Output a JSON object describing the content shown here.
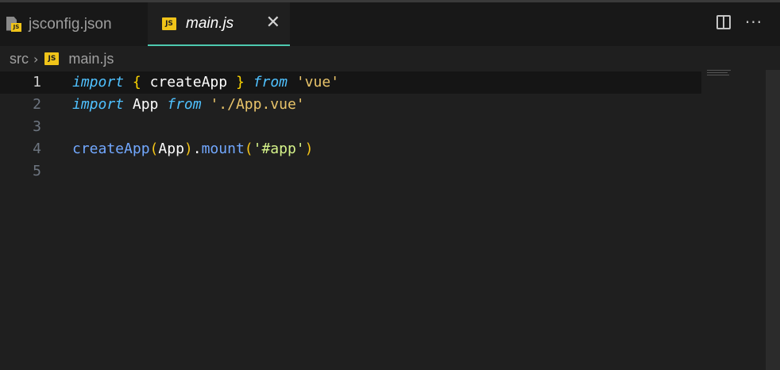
{
  "tabs": [
    {
      "label": "jsconfig.json",
      "icon": "json-file-icon",
      "active": false
    },
    {
      "label": "main.js",
      "icon": "js-file-icon",
      "active": true,
      "close": "✕"
    }
  ],
  "icons": {
    "js_badge": "JS",
    "json_badge": "JS",
    "more": "···"
  },
  "breadcrumb": {
    "folder": "src",
    "separator": "›",
    "file": "main.js"
  },
  "editor": {
    "line_numbers": [
      "1",
      "2",
      "3",
      "4",
      "5"
    ],
    "lines": {
      "l1": {
        "kw1": "import",
        "b1": "{",
        "id": "createApp",
        "b2": "}",
        "kw2": "from",
        "str": "'vue'"
      },
      "l2": {
        "kw1": "import",
        "id": "App",
        "kw2": "from",
        "str": "'./App.vue'"
      },
      "l4": {
        "fn1": "createApp",
        "p1": "(",
        "id": "App",
        "p2": ")",
        "dot": ".",
        "fn2": "mount",
        "p3": "(",
        "str": "'#app'",
        "p4": ")"
      }
    }
  },
  "colors": {
    "accent": "#4ec9b0",
    "keyword": "#4fc1ff",
    "string": "#e9c46a",
    "function": "#72a8ff"
  }
}
